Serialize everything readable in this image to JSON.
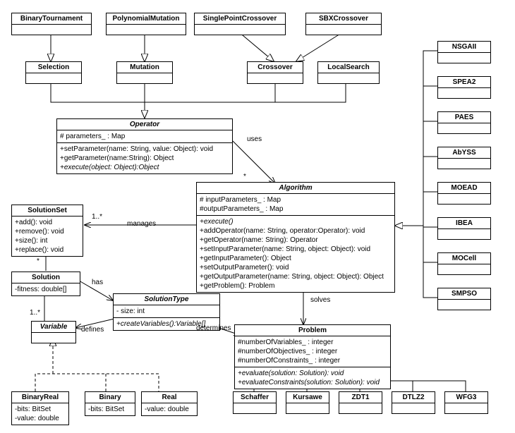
{
  "top": {
    "bt": "BinaryTournament",
    "pm": "PolynomialMutation",
    "spc": "SinglePointCrossover",
    "sbx": "SBXCrossover"
  },
  "mid": {
    "sel": "Selection",
    "mut": "Mutation",
    "cro": "Crossover",
    "ls": "LocalSearch"
  },
  "operator": {
    "title": "Operator",
    "a": [
      "# parameters_ : Map"
    ],
    "m": [
      "+setParameter(name: String, value: Object): void",
      "+getParameter(name:String): Object",
      "+execute(object: Object):Object"
    ]
  },
  "algorithm": {
    "title": "Algorithm",
    "a": [
      "# inputParameters_ : Map",
      "#outputParameters_ : Map"
    ],
    "m": [
      "+execute()",
      "+addOperator(name: String, operator:Operator): void",
      "+getOperator(name: String): Operator",
      "+setInputParameter(name: String, object: Object): void",
      "+getInputParameter(): Object",
      "+setOutputParameter(): void",
      "+getOutputParameter(name: String, object: Object): Object",
      "+getProblem(): Problem"
    ]
  },
  "solutionset": {
    "title": "SolutionSet",
    "m": [
      "+add(): void",
      "+remove(): void",
      "+size(): int",
      "+replace(): void"
    ]
  },
  "solution": {
    "title": "Solution",
    "a": [
      "-fitness: double[]"
    ]
  },
  "solutiontype": {
    "title": "SolutionType",
    "a": [
      "- size: int"
    ],
    "m": [
      "+createVariables():Variable[]"
    ]
  },
  "variable": {
    "title": "Variable"
  },
  "problem": {
    "title": "Problem",
    "a": [
      "#numberOfVariables_ : integer",
      "#numberOfObjectives_ : integer",
      "#numberOfConstraints_ : integer"
    ],
    "m": [
      "+evaluate(solution: Solution): void",
      "+evaluateConstraints(solution: Solution): void"
    ]
  },
  "vars": {
    "br": {
      "t": "BinaryReal",
      "a": [
        "-bits: BitSet",
        "-value: double"
      ]
    },
    "bi": {
      "t": "Binary",
      "a": [
        "-bits: BitSet"
      ]
    },
    "re": {
      "t": "Real",
      "a": [
        "-value: double"
      ]
    }
  },
  "probs": {
    "sc": "Schaffer",
    "ku": "Kursawe",
    "zd": "ZDT1",
    "dt": "DTLZ2",
    "wf": "WFG3"
  },
  "algos": {
    "a1": "NSGAII",
    "a2": "SPEA2",
    "a3": "PAES",
    "a4": "AbYSS",
    "a5": "MOEAD",
    "a6": "IBEA",
    "a7": "MOCell",
    "a8": "SMPSO"
  },
  "rel": {
    "uses": "uses",
    "manages": "manages",
    "has": "has",
    "defines": "defines",
    "determines": "determines",
    "solves": "solves",
    "m1": "1..*",
    "m2": "*",
    "m3": "*",
    "m4": "1..*"
  }
}
